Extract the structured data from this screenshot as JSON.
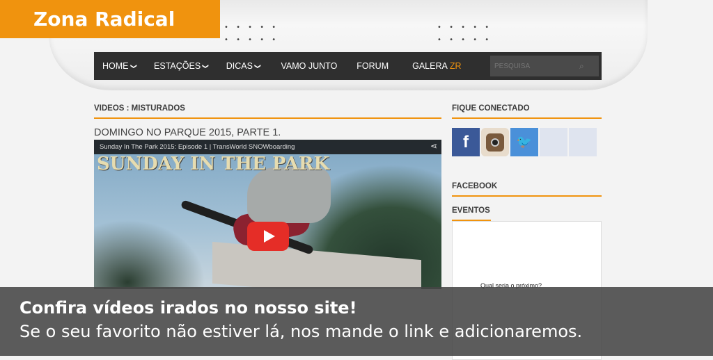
{
  "brand": {
    "title": "Zona Radical"
  },
  "nav": {
    "items": [
      {
        "label": "HOME",
        "dropdown": true
      },
      {
        "label": "ESTAÇÕES",
        "dropdown": true
      },
      {
        "label": "DICAS",
        "dropdown": true
      },
      {
        "label": "VAMO JUNTO",
        "dropdown": false
      },
      {
        "label": "FORUM",
        "dropdown": false
      },
      {
        "label": "GALERA",
        "suffix": "ZR",
        "dropdown": false
      }
    ],
    "search_placeholder": "PESQUISA"
  },
  "main": {
    "section_title": "VIDEOS : MISTURADOS",
    "post_title": "DOMINGO NO PARQUE 2015, PARTE 1.",
    "video": {
      "title": "Sunday In The Park 2015: Episode 1 | TransWorld SNOWboarding",
      "overlay_logo": "SUNDAY IN THE PARK"
    }
  },
  "sidebar": {
    "connect_title": "FIQUE CONECTADO",
    "facebook_title": "FACEBOOK",
    "events_title": "EVENTOS",
    "events_text": "Qual seria o próximo?",
    "social": [
      {
        "name": "facebook",
        "glyph": "f"
      },
      {
        "name": "instagram",
        "glyph": ""
      },
      {
        "name": "twitter",
        "glyph": "🐦"
      }
    ]
  },
  "caption": {
    "headline": "Confira vídeos irados no nosso site!",
    "subtext": "Se o seu favorito não estiver lá, nos mande o link e adicionaremos."
  },
  "colors": {
    "accent": "#f0930e",
    "nav_bg": "#2f2f2f",
    "facebook": "#3b5998",
    "twitter": "#4a90d9",
    "youtube_red": "#e52d27"
  }
}
